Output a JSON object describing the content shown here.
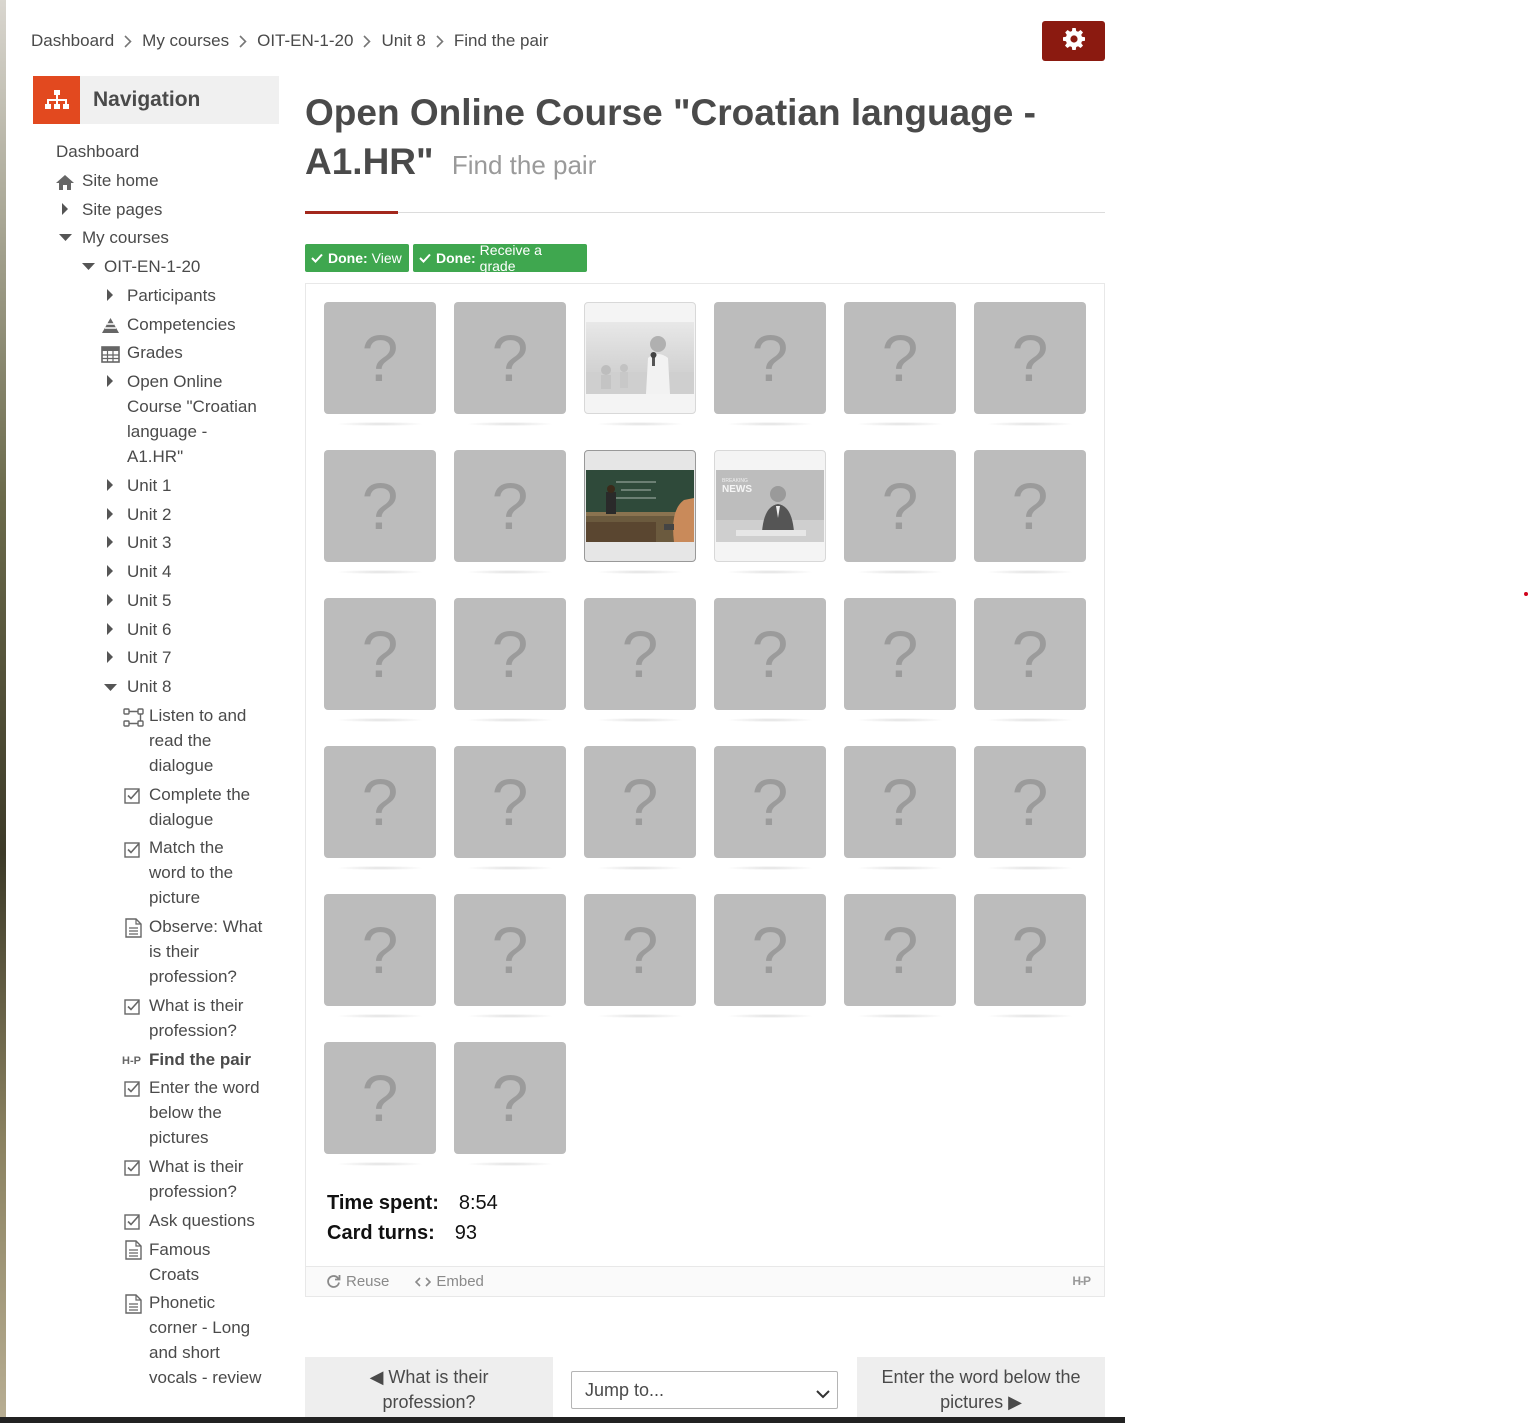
{
  "breadcrumb": {
    "items": [
      "Dashboard",
      "My courses",
      "OIT-EN-1-20",
      "Unit 8",
      "Find the pair"
    ]
  },
  "settings": {
    "icon": "gear-icon",
    "color": "#8b1a10"
  },
  "navigation": {
    "title": "Navigation",
    "icon": "sitemap-icon",
    "accent": "#e2491f",
    "items": [
      {
        "label": "Dashboard",
        "icon": "none"
      },
      {
        "label": "Site home",
        "icon": "home-icon"
      },
      {
        "label": "Site pages",
        "icon": "caret-right-icon"
      },
      {
        "label": "My courses",
        "icon": "caret-down-icon"
      },
      {
        "label": "OIT-EN-1-20",
        "icon": "caret-down-icon"
      },
      {
        "label": "Participants",
        "icon": "caret-right-icon"
      },
      {
        "label": "Competencies",
        "icon": "competencies-icon"
      },
      {
        "label": "Grades",
        "icon": "table-icon"
      },
      {
        "label": "Open Online Course \"Croatian language - A1.HR\"",
        "icon": "caret-right-icon"
      },
      {
        "label": "Unit 1",
        "icon": "caret-right-icon"
      },
      {
        "label": "Unit 2",
        "icon": "caret-right-icon"
      },
      {
        "label": "Unit 3",
        "icon": "caret-right-icon"
      },
      {
        "label": "Unit 4",
        "icon": "caret-right-icon"
      },
      {
        "label": "Unit 5",
        "icon": "caret-right-icon"
      },
      {
        "label": "Unit 6",
        "icon": "caret-right-icon"
      },
      {
        "label": "Unit 7",
        "icon": "caret-right-icon"
      },
      {
        "label": "Unit 8",
        "icon": "caret-down-icon"
      },
      {
        "label": "Listen to and read the dialogue",
        "icon": "lesson-icon"
      },
      {
        "label": "Complete the dialogue",
        "icon": "quiz-icon"
      },
      {
        "label": "Match the word to the picture",
        "icon": "quiz-icon"
      },
      {
        "label": "Observe: What is their profession?",
        "icon": "page-icon"
      },
      {
        "label": "What is their profession?",
        "icon": "quiz-icon"
      },
      {
        "label": "Find the pair",
        "icon": "h5p-icon",
        "active": true
      },
      {
        "label": "Enter the word below the pictures",
        "icon": "quiz-icon"
      },
      {
        "label": "What is their profession?",
        "icon": "quiz-icon"
      },
      {
        "label": "Ask questions",
        "icon": "quiz-icon"
      },
      {
        "label": "Famous Croats",
        "icon": "page-icon"
      },
      {
        "label": "Phonetic corner - Long and short vocals - review",
        "icon": "page-icon"
      }
    ]
  },
  "page": {
    "title": "Open Online Course \"Croatian language - A1.HR\"",
    "subtitle": "Find the pair",
    "accent": "#a3281c"
  },
  "completion": [
    {
      "prefix": "Done:",
      "text": "View"
    },
    {
      "prefix": "Done:",
      "text": "Receive a grade"
    }
  ],
  "game": {
    "card_symbol": "?",
    "cards": [
      {
        "state": "hidden"
      },
      {
        "state": "hidden"
      },
      {
        "state": "flipped",
        "image": "reporter-photo"
      },
      {
        "state": "hidden"
      },
      {
        "state": "hidden"
      },
      {
        "state": "hidden"
      },
      {
        "state": "hidden"
      },
      {
        "state": "hidden"
      },
      {
        "state": "flipped",
        "image": "classroom-photo"
      },
      {
        "state": "flipped",
        "image": "news-anchor-photo"
      },
      {
        "state": "hidden"
      },
      {
        "state": "hidden"
      },
      {
        "state": "hidden"
      },
      {
        "state": "hidden"
      },
      {
        "state": "hidden"
      },
      {
        "state": "hidden"
      },
      {
        "state": "hidden"
      },
      {
        "state": "hidden"
      },
      {
        "state": "hidden"
      },
      {
        "state": "hidden"
      },
      {
        "state": "hidden"
      },
      {
        "state": "hidden"
      },
      {
        "state": "hidden"
      },
      {
        "state": "hidden"
      },
      {
        "state": "hidden"
      },
      {
        "state": "hidden"
      },
      {
        "state": "hidden"
      },
      {
        "state": "hidden"
      },
      {
        "state": "hidden"
      },
      {
        "state": "hidden"
      },
      {
        "state": "hidden"
      },
      {
        "state": "hidden"
      }
    ],
    "news_text_1": "BREAKING",
    "news_text_2": "NEWS",
    "stats": {
      "time_label": "Time spent:",
      "time_value": "8:54",
      "turns_label": "Card turns:",
      "turns_value": "93"
    }
  },
  "h5p_footer": {
    "reuse": "Reuse",
    "embed": "Embed",
    "logo": "H-P"
  },
  "bottom_nav": {
    "prev": "◀ What is their profession?",
    "jump": "Jump to...",
    "next": "Enter the word below the pictures ▶"
  }
}
